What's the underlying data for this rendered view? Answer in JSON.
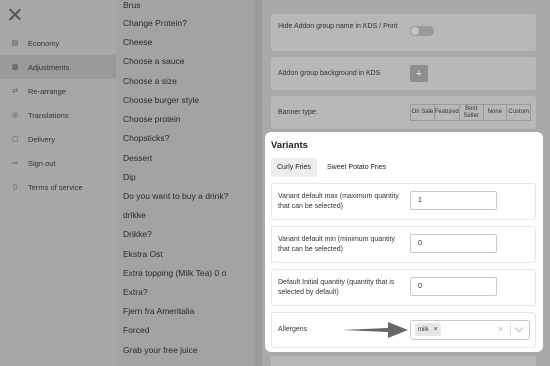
{
  "sidebar": {
    "items": [
      {
        "label": "Economy",
        "icon": "ledger-icon"
      },
      {
        "label": "Adjustments",
        "icon": "sliders-icon",
        "active": true
      },
      {
        "label": "Re-arrange",
        "icon": "shuffle-icon"
      },
      {
        "label": "Translations",
        "icon": "globe-icon"
      },
      {
        "label": "Delivery",
        "icon": "truck-icon"
      },
      {
        "label": "Sign out",
        "icon": "sign-out-icon"
      },
      {
        "label": "Terms of service",
        "icon": "document-icon"
      }
    ]
  },
  "addon_groups": [
    "Brus",
    "Change Protein?",
    "Cheese",
    "Choose a sauce",
    "Choose a size",
    "Choose burger style",
    "Choose protein",
    "Chopsticks?",
    "Dessert",
    "Dip",
    "Do you want to buy a drink?",
    "drikke",
    "Drikke?",
    "Ekstra Ost",
    "Extra topping (Milk Tea) 0 o",
    "Extra?",
    "Fjern fra Ameritalia",
    "Forced",
    "Grab your free juice"
  ],
  "settings": {
    "hide_name_label": "Hide Addon group name in KDS / Print",
    "background_label": "Addon group background in KDS",
    "background_button": "+",
    "banner_label": "Banner type:",
    "banner_options": [
      "On Sale",
      "Featured",
      "Best Seller",
      "None",
      "Custom"
    ]
  },
  "variants": {
    "title": "Variants",
    "tabs": [
      "Curly Fries",
      "Sweet Potato Fries"
    ],
    "max_label": "Variant default max (maximum quantity that can be selected)",
    "max_value": "1",
    "min_label": "Variant default min (minimum quantity that can be selected)",
    "min_value": "0",
    "initial_label": "Default Initial quantity (quantity that is selected by default)",
    "initial_value": "0",
    "allergens_label": "Allergens",
    "allergen_chip": "milk",
    "chip_remove": "×",
    "clear_symbol": "×"
  }
}
